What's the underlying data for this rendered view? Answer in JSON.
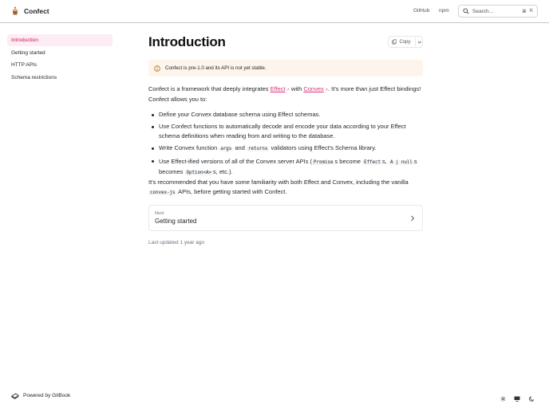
{
  "header": {
    "brand": "Confect",
    "links": [
      "GitHub",
      "npm"
    ],
    "search": {
      "placeholder": "Search...",
      "shortcut_mod": "⌘",
      "shortcut_key": "K"
    }
  },
  "sidebar": {
    "items": [
      {
        "label": "Introduction",
        "active": true
      },
      {
        "label": "Getting started",
        "active": false
      },
      {
        "label": "HTTP APIs",
        "active": false
      },
      {
        "label": "Schema restrictions",
        "active": false
      }
    ]
  },
  "page": {
    "title": "Introduction",
    "copy_label": "Copy",
    "hint": "Confect is pre-1.0 and its API is not yet stable.",
    "intro": {
      "before": "Confect is a framework that deeply integrates ",
      "link1": "Effect",
      "mid": " with ",
      "link2": "Convex",
      "after": ". It's more than just Effect bindings! Confect allows you to:"
    },
    "bullets": {
      "b1": "Define your Convex database schema using Effect schemas.",
      "b2": "Use Confect functions to automatically decode and encode your data according to your Effect schema definitions when reading from and writing to the database.",
      "b3_a": "Write Convex function ",
      "b3_code1": "args",
      "b3_b": " and ",
      "b3_code2": "returns",
      "b3_c": " validators using Effect's Schema library.",
      "b4_a": "Use Effect-ified versions of all of the Convex server APIs (",
      "b4_code1": "Promise",
      "b4_b": "s become ",
      "b4_code2": "Effect",
      "b4_c": "s, ",
      "b4_code3": "A | null",
      "b4_d": "s becomes ",
      "b4_code4": "Option<A>",
      "b4_e": "s, etc.)."
    },
    "recommend": {
      "before": "It's recommended that you have some familiarity with both Effect and Convex, including the vanilla ",
      "code": "convex-js",
      "after": " APIs, before getting started with Confect."
    },
    "next": {
      "small": "Next",
      "title": "Getting started"
    },
    "updated": "Last updated 1 year ago"
  },
  "footer": {
    "powered": "Powered by GitBook"
  },
  "colors": {
    "accent": "#d6377a",
    "active_bg": "#fdecf3",
    "hint_bg": "#fdf4ec"
  }
}
